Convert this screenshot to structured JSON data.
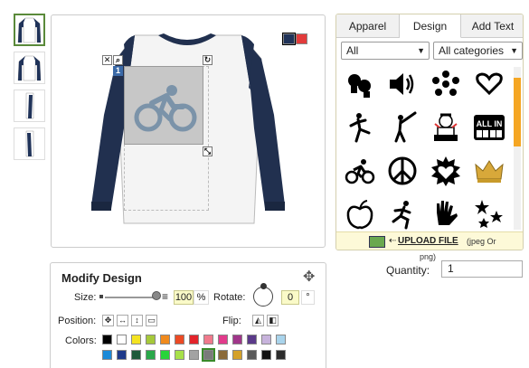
{
  "tabs": [
    {
      "label": "Apparel",
      "active": false
    },
    {
      "label": "Design",
      "active": true
    },
    {
      "label": "Add Text",
      "active": false
    }
  ],
  "filters": {
    "category_main": "All",
    "category_sub": "All categories"
  },
  "clipart": [
    "boxing-gloves-icon",
    "speaker-icon",
    "hearts-circle-icon",
    "hands-heart-icon",
    "soccer-kick-icon",
    "baseball-batter-icon",
    "snoopy-icon",
    "all-in-cards-icon",
    "cyclist-icon",
    "peace-sign-icon",
    "heart-burst-icon",
    "crown-icon",
    "apple-icon",
    "runner-icon",
    "handprint-icon",
    "stars-icon"
  ],
  "upload": {
    "label": "UPLOAD FILE",
    "hint": "(jpeg Or",
    "hint_cont": "png)"
  },
  "quantity": {
    "label": "Quantity:",
    "value": "1"
  },
  "shirt_swatches": [
    "#203359",
    "#e23b3b"
  ],
  "modify": {
    "title": "Modify Design",
    "size_label": "Size:",
    "size_value": "100",
    "size_unit": "%",
    "rotate_label": "Rotate:",
    "rotate_value": "0",
    "rotate_unit": "°",
    "position_label": "Position:",
    "flip_label": "Flip:",
    "colors_label": "Colors:",
    "colors_row1": [
      "#000000",
      "#ffffff",
      "#f4e321",
      "#a6c93a",
      "#f08a1c",
      "#ec4a24",
      "#e3242b",
      "#f07a8c",
      "#e23b8c",
      "#a0368a",
      "#5b3a8a",
      "#c7b3dc",
      "#a9d4ec"
    ],
    "colors_row2": [
      "#1c8ad8",
      "#1f3a8a",
      "#1f5a3a",
      "#2aa84a",
      "#27d43a",
      "#a7e04a",
      "#a3a3a3",
      "#7a7a7a",
      "#8a6a3a",
      "#d4a12a",
      "#5a5a5a",
      "#111111",
      "#2c2c2c"
    ],
    "selected_color": "#7a7a7a"
  }
}
